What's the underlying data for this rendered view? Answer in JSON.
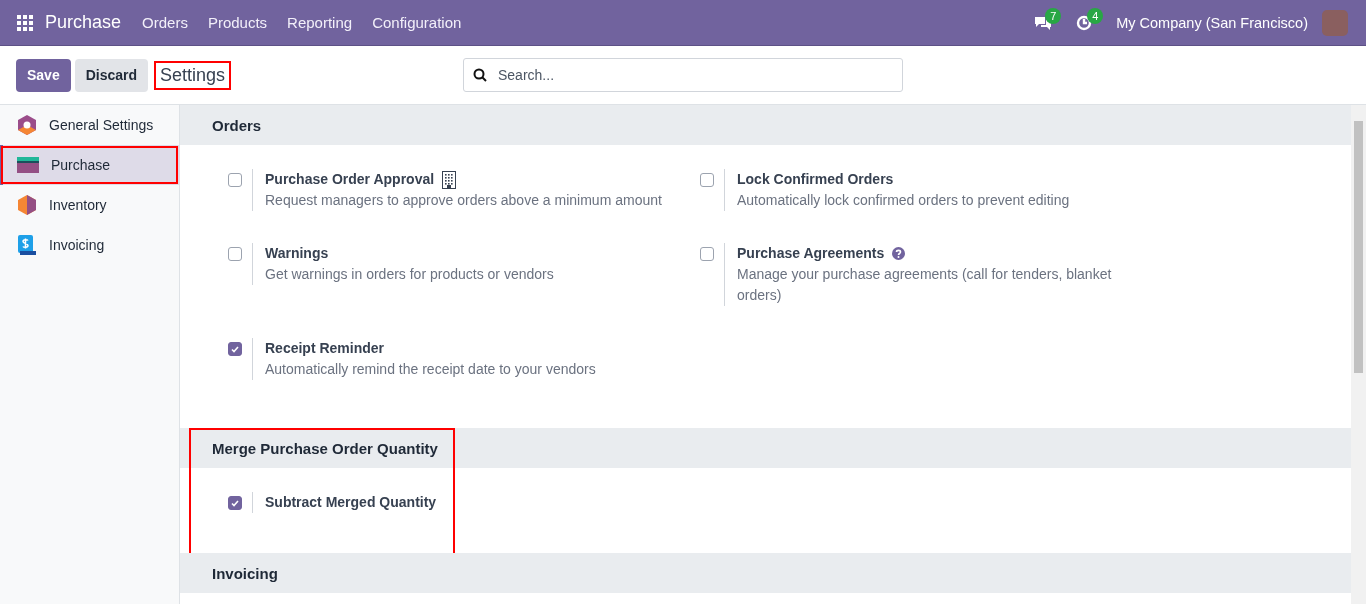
{
  "navbar": {
    "app_name": "Purchase",
    "menu": [
      "Orders",
      "Products",
      "Reporting",
      "Configuration"
    ],
    "messages_count": "7",
    "activities_count": "4",
    "company": "My Company (San Francisco)"
  },
  "control_panel": {
    "buttons": [
      {
        "label": "Save",
        "kind": "primary"
      },
      {
        "label": "Discard",
        "kind": "secondary"
      }
    ],
    "title": "Settings",
    "title_highlighted": true,
    "search": {
      "placeholder": "Search..."
    }
  },
  "sidebar": {
    "items": [
      {
        "label": "General Settings",
        "kind": "general",
        "selected": false,
        "highlighted": false
      },
      {
        "label": "Purchase",
        "kind": "purchase",
        "selected": true,
        "highlighted": true
      },
      {
        "label": "Inventory",
        "kind": "inventory",
        "selected": false,
        "highlighted": false
      },
      {
        "label": "Invoicing",
        "kind": "invoicing",
        "selected": false,
        "highlighted": false
      }
    ]
  },
  "sections": [
    {
      "title": "Orders",
      "highlighted": false,
      "settings": [
        {
          "title": "Purchase Order Approval",
          "description": "Request managers to approve orders above a minimum amount",
          "checked": false,
          "kind": "company_specific"
        },
        {
          "title": "Lock Confirmed Orders",
          "description": "Automatically lock confirmed orders to prevent editing",
          "checked": false
        },
        {
          "title": "Warnings",
          "description": "Get warnings in orders for products or vendors",
          "checked": false
        },
        {
          "title": "Purchase Agreements",
          "description": "Manage your purchase agreements (call for tenders, blanket orders)",
          "checked": false,
          "kind": "with_help"
        },
        {
          "title": "Receipt Reminder",
          "description": "Automatically remind the receipt date to your vendors",
          "checked": true
        }
      ]
    },
    {
      "title": "Merge Purchase Order Quantity",
      "highlighted": true,
      "settings": [
        {
          "title": "Subtract Merged Quantity",
          "checked": true
        }
      ]
    },
    {
      "title": "Invoicing",
      "highlighted": false
    }
  ]
}
